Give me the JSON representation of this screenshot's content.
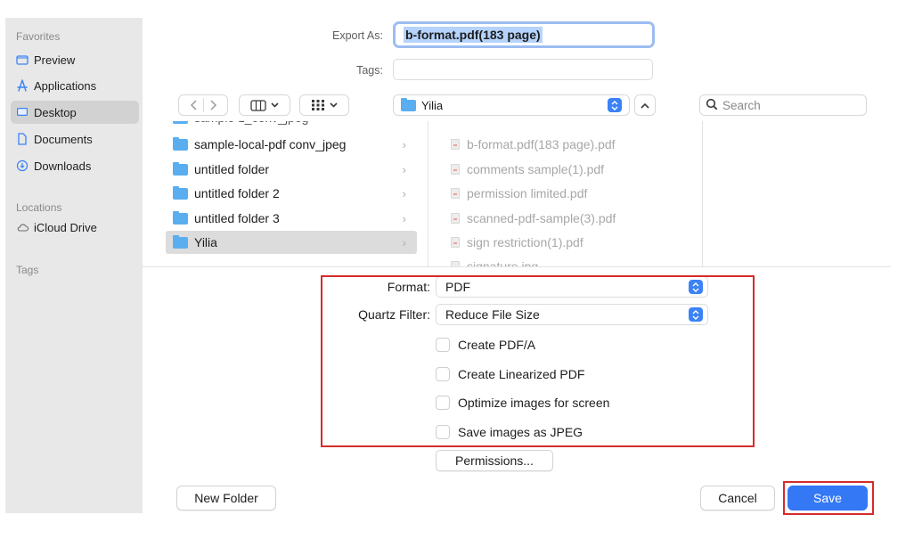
{
  "sidebar": {
    "favorites_label": "Favorites",
    "items": [
      {
        "label": "Preview"
      },
      {
        "label": "Applications"
      },
      {
        "label": "Desktop"
      },
      {
        "label": "Documents"
      },
      {
        "label": "Downloads"
      }
    ],
    "locations_label": "Locations",
    "locations": [
      {
        "label": "iCloud Drive"
      }
    ],
    "tags_label": "Tags"
  },
  "header": {
    "export_label": "Export As:",
    "export_value": "b-format.pdf(183 page)",
    "tags_label": "Tags:",
    "tags_value": ""
  },
  "toolbar": {
    "location": "Yilia",
    "search_placeholder": "Search"
  },
  "browser": {
    "partial_top": "sample-z_conv_jpeg",
    "folders": [
      {
        "name": "sample-local-pdf conv_jpeg"
      },
      {
        "name": "untitled folder"
      },
      {
        "name": "untitled folder 2"
      },
      {
        "name": "untitled folder 3"
      },
      {
        "name": "Yilia"
      }
    ],
    "files": [
      {
        "name": "b-format.pdf(183 page).pdf"
      },
      {
        "name": "comments sample(1).pdf"
      },
      {
        "name": "permission limited.pdf"
      },
      {
        "name": "scanned-pdf-sample(3).pdf"
      },
      {
        "name": "sign restriction(1).pdf"
      },
      {
        "name": "signature.jpg"
      }
    ]
  },
  "options": {
    "format_label": "Format:",
    "format_value": "PDF",
    "quartz_label": "Quartz Filter:",
    "quartz_value": "Reduce File Size",
    "checkboxes": [
      {
        "label": "Create PDF/A",
        "checked": false
      },
      {
        "label": "Create Linearized PDF",
        "checked": false
      },
      {
        "label": "Optimize images for screen",
        "checked": false
      },
      {
        "label": "Save images as JPEG",
        "checked": false
      }
    ],
    "permissions_label": "Permissions..."
  },
  "footer": {
    "new_folder_label": "New Folder",
    "cancel_label": "Cancel",
    "save_label": "Save"
  },
  "colors": {
    "accent": "#3478f6",
    "highlight": "#d62b2b",
    "sidebar_bg": "#e8e8e8"
  }
}
